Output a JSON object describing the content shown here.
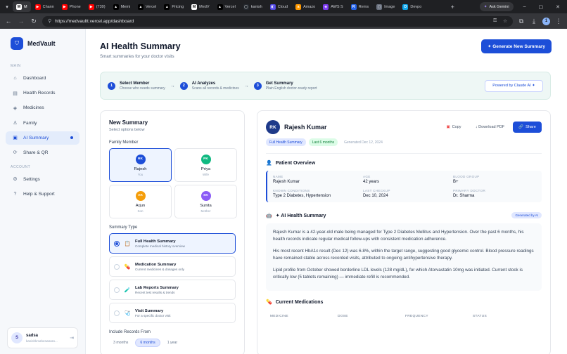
{
  "browser": {
    "tabs": [
      {
        "label": "M",
        "color": "#ffffff",
        "glyph": "M",
        "active": true
      },
      {
        "label": "Chann",
        "color": "#ff0000",
        "glyph": "▶"
      },
      {
        "label": "Phone",
        "color": "#ff0000",
        "glyph": "▶"
      },
      {
        "label": "(739) ",
        "color": "#ff0000",
        "glyph": "▶"
      },
      {
        "label": "Memi",
        "color": "#000000",
        "glyph": "▲"
      },
      {
        "label": "Vercel",
        "color": "#000000",
        "glyph": "▲"
      },
      {
        "label": "Pricing",
        "color": "#000000",
        "glyph": "▲"
      },
      {
        "label": "MedV",
        "color": "#ffffff",
        "glyph": "M"
      },
      {
        "label": "Vercel",
        "color": "#000000",
        "glyph": "▲"
      },
      {
        "label": "kanish",
        "color": "#24292f",
        "glyph": "◯"
      },
      {
        "label": "Cloud",
        "color": "#4f46e5",
        "glyph": "◧"
      },
      {
        "label": "Amazo",
        "color": "#ff9900",
        "glyph": "a"
      },
      {
        "label": "AWS S",
        "color": "#7c3aed",
        "glyph": "◈"
      },
      {
        "label": "Rems",
        "color": "#2563eb",
        "glyph": "R"
      },
      {
        "label": "Image",
        "color": "#6b7280",
        "glyph": "▢"
      },
      {
        "label": "Devpo",
        "color": "#0ea5e9",
        "glyph": "D"
      }
    ],
    "new_tab": "+",
    "ask_gemini": "Ask Gemini",
    "url": "https://medvaultt.vercel.app/dashboard",
    "window_controls": {
      "min": "–",
      "max": "▢",
      "close": "✕"
    }
  },
  "sidebar": {
    "brand": "MedVault",
    "main_label": "MAIN",
    "main_items": [
      {
        "label": "Dashboard",
        "icon": "⌂",
        "active": false
      },
      {
        "label": "Health Records",
        "icon": "▤",
        "active": false
      },
      {
        "label": "Medicines",
        "icon": "◈",
        "active": false
      },
      {
        "label": "Family",
        "icon": "♙",
        "active": false
      },
      {
        "label": "AI Summary",
        "icon": "▣",
        "active": true
      },
      {
        "label": "Share & QR",
        "icon": "⟳",
        "active": false
      }
    ],
    "account_label": "ACCOUNT",
    "account_items": [
      {
        "label": "Settings",
        "icon": "⚙"
      },
      {
        "label": "Help & Support",
        "icon": "?"
      }
    ],
    "user": {
      "initial": "S",
      "name": "sadsa",
      "email": "kanishkmaheswaran..."
    }
  },
  "header": {
    "title": "AI Health Summary",
    "subtitle": "Smart summaries for your doctor visits",
    "generate_button": "✦ Generate New Summary"
  },
  "steps": [
    {
      "num": "1",
      "title": "Select Member",
      "desc": "Choose who needs summary"
    },
    {
      "num": "2",
      "title": "AI Analyzes",
      "desc": "Scans all records & medicines"
    },
    {
      "num": "3",
      "title": "Get Summary",
      "desc": "Plain English doctor-ready report"
    }
  ],
  "powered": "Powered by Claude AI ✦",
  "new_summary": {
    "title": "New Summary",
    "subtitle": "Select options below",
    "family_label": "Family Member",
    "members": [
      {
        "initials": "RK",
        "name": "Rajesh",
        "relation": "You",
        "color": "#1d4ed8",
        "selected": true
      },
      {
        "initials": "PK",
        "name": "Priya",
        "relation": "Wife",
        "color": "#10b981",
        "selected": false
      },
      {
        "initials": "AK",
        "name": "Arjun",
        "relation": "Son",
        "color": "#f59e0b",
        "selected": false
      },
      {
        "initials": "SK",
        "name": "Sunita",
        "relation": "Mother",
        "color": "#8b5cf6",
        "selected": false
      }
    ],
    "type_label": "Summary Type",
    "types": [
      {
        "title": "Full Health Summary",
        "desc": "Complete medical history overview",
        "icon": "📋",
        "selected": true
      },
      {
        "title": "Medication Summary",
        "desc": "Current medicines & dosages only",
        "icon": "💊",
        "selected": false
      },
      {
        "title": "Lab Reports Summary",
        "desc": "Recent test results & trends",
        "icon": "🧪",
        "selected": false
      },
      {
        "title": "Visit Summary",
        "desc": "For a specific doctor visit",
        "icon": "🩺",
        "selected": false
      }
    ],
    "range_label": "Include Records From",
    "ranges": [
      {
        "label": "3 months",
        "selected": false
      },
      {
        "label": "6 months",
        "selected": true
      },
      {
        "label": "1 year",
        "selected": false
      }
    ]
  },
  "report": {
    "initials": "RK",
    "name": "Rajesh Kumar",
    "copy": "Copy",
    "download": "↓ Download PDF",
    "share": "Share",
    "chips": [
      "Full Health Summary",
      "Last 6 months",
      "Generated Dec 12, 2024"
    ],
    "overview_title": "Patient Overview",
    "overview": [
      {
        "k": "NAME",
        "v": "Rajesh Kumar"
      },
      {
        "k": "AGE",
        "v": "42 years"
      },
      {
        "k": "BLOOD GROUP",
        "v": "B+"
      },
      {
        "k": "KNOWN CONDITIONS",
        "v": "Type 2 Diabetes, Hypertension"
      },
      {
        "k": "LAST CHECKUP",
        "v": "Dec 10, 2024"
      },
      {
        "k": "PRIMARY DOCTOR",
        "v": "Dr. Sharma"
      }
    ],
    "ai_title": "✦ AI Health Summary",
    "ai_badge": "Generated by AI",
    "paragraphs": [
      "Rajesh Kumar is a 42-year-old male being managed for Type 2 Diabetes Mellitus and Hypertension. Over the past 6 months, his health records indicate regular medical follow-ups with consistent medication adherence.",
      "His most recent HbA1c result (Dec 12) was 6.8%, within the target range, suggesting good glycemic control. Blood pressure readings have remained stable across recorded visits, attributed to ongoing antihypertensive therapy.",
      "Lipid profile from October showed borderline LDL levels (128 mg/dL), for which Atorvastatin 10mg was initiated. Current stock is critically low (5 tablets remaining) — immediate refill is recommended."
    ],
    "meds_title": "Current Medications",
    "med_headers": [
      "MEDICINE",
      "DOSE",
      "FREQUENCY",
      "STATUS"
    ]
  }
}
